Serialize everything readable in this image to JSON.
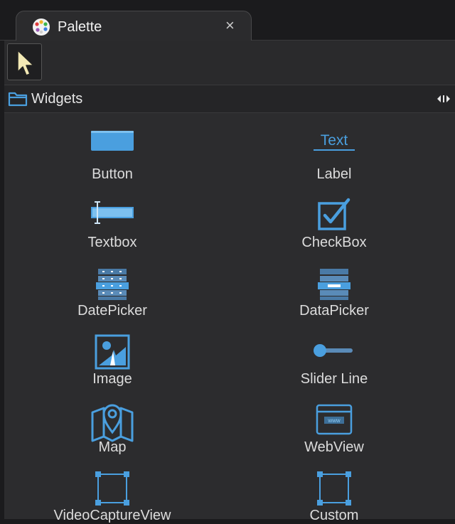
{
  "panel": {
    "tab_title": "Palette",
    "tab_close": "×"
  },
  "toolbar": {
    "pointer_tool": "pointer-arrow-icon"
  },
  "section": {
    "title": "Widgets"
  },
  "widgets": [
    {
      "label": "Button",
      "icon": "button-icon"
    },
    {
      "label": "Label",
      "icon": "label-text-icon",
      "icon_text": "Text"
    },
    {
      "label": "Textbox",
      "icon": "textbox-icon"
    },
    {
      "label": "CheckBox",
      "icon": "checkbox-icon"
    },
    {
      "label": "DatePicker",
      "icon": "datepicker-icon"
    },
    {
      "label": "DataPicker",
      "icon": "datapicker-icon"
    },
    {
      "label": "Image",
      "icon": "image-icon"
    },
    {
      "label": "Slider Line",
      "icon": "slider-icon"
    },
    {
      "label": "Map",
      "icon": "map-icon"
    },
    {
      "label": "WebView",
      "icon": "webview-icon"
    },
    {
      "label": "VideoCaptureView",
      "icon": "video-capture-icon"
    },
    {
      "label": "Custom",
      "icon": "custom-icon"
    }
  ],
  "colors": {
    "accent": "#4a9fdf",
    "background": "#2c2c2e",
    "text": "#dcdcdc"
  }
}
